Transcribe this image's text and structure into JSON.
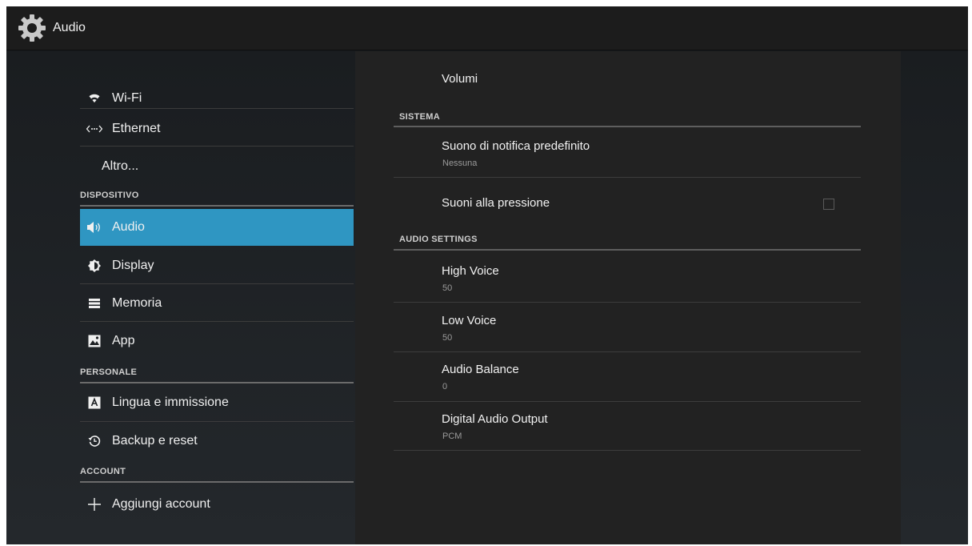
{
  "actionbar": {
    "title": "Audio",
    "icon": "gear-icon"
  },
  "sidebar": {
    "items": [
      {
        "label": "Wi-Fi",
        "icon": "wifi-icon"
      },
      {
        "label": "Ethernet",
        "icon": "ethernet-icon"
      },
      {
        "label": "Altro...",
        "icon": ""
      },
      {
        "label": "Audio",
        "icon": "speaker-icon",
        "selected": true
      },
      {
        "label": "Display",
        "icon": "brightness-icon"
      },
      {
        "label": "Memoria",
        "icon": "storage-icon"
      },
      {
        "label": "App",
        "icon": "apps-icon"
      },
      {
        "label": "Lingua e immissione",
        "icon": "language-icon"
      },
      {
        "label": "Backup e reset",
        "icon": "backup-icon"
      },
      {
        "label": "Aggiungi account",
        "icon": "plus-icon"
      }
    ],
    "sections": [
      "DISPOSITIVO",
      "PERSONALE",
      "ACCOUNT"
    ]
  },
  "detail": {
    "volumi": "Volumi",
    "sections": [
      "SISTEMA",
      "AUDIO SETTINGS"
    ],
    "notification": {
      "title": "Suono di notifica predefinito",
      "summary": "Nessuna"
    },
    "touch_sounds": {
      "title": "Suoni alla pressione",
      "checked": false
    },
    "high_voice": {
      "title": "High Voice",
      "summary": "50"
    },
    "low_voice": {
      "title": "Low Voice",
      "summary": "50"
    },
    "balance": {
      "title": "Audio Balance",
      "summary": "0"
    },
    "digital_output": {
      "title": "Digital Audio Output",
      "summary": "PCM"
    }
  },
  "colors": {
    "accent": "#2f96c2",
    "background": "#16191c",
    "panel": "#222222"
  }
}
